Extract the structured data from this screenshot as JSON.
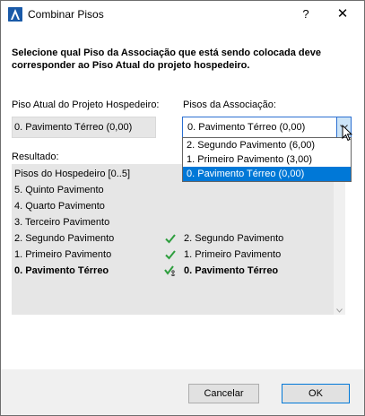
{
  "window": {
    "title": "Combinar Pisos",
    "help_label": "?",
    "close_label": "✕"
  },
  "instructions": "Selecione qual Piso da Associação que está sendo colocada deve corresponder ao Piso Atual do projeto hospedeiro.",
  "host": {
    "label": "Piso Atual do Projeto Hospedeiro:",
    "value": "0. Pavimento Térreo (0,00)"
  },
  "association": {
    "label": "Pisos da Associação:",
    "selected": "0. Pavimento Térreo (0,00)",
    "options": [
      "2. Segundo Pavimento (6,00)",
      "1. Primeiro Pavimento (3,00)",
      "0. Pavimento Térreo (0,00)"
    ]
  },
  "result": {
    "label": "Resultado:",
    "rows": [
      {
        "host": "Pisos do Hospedeiro [0..5]",
        "check": "none",
        "assoc": ""
      },
      {
        "host": "5. Quinto Pavimento",
        "check": "none",
        "assoc": ""
      },
      {
        "host": "4. Quarto Pavimento",
        "check": "none",
        "assoc": ""
      },
      {
        "host": "3. Terceiro Pavimento",
        "check": "none",
        "assoc": ""
      },
      {
        "host": "2. Segundo Pavimento",
        "check": "check",
        "assoc": "2. Segundo Pavimento"
      },
      {
        "host": "1. Primeiro Pavimento",
        "check": "check",
        "assoc": "1. Primeiro Pavimento"
      },
      {
        "host": "0. Pavimento Térreo",
        "check": "anchor",
        "assoc": "0. Pavimento Térreo"
      }
    ]
  },
  "buttons": {
    "cancel": "Cancelar",
    "ok": "OK"
  },
  "colors": {
    "accent": "#0078d7",
    "check": "#2e9e3e",
    "list_bg": "#e6e6e6"
  }
}
